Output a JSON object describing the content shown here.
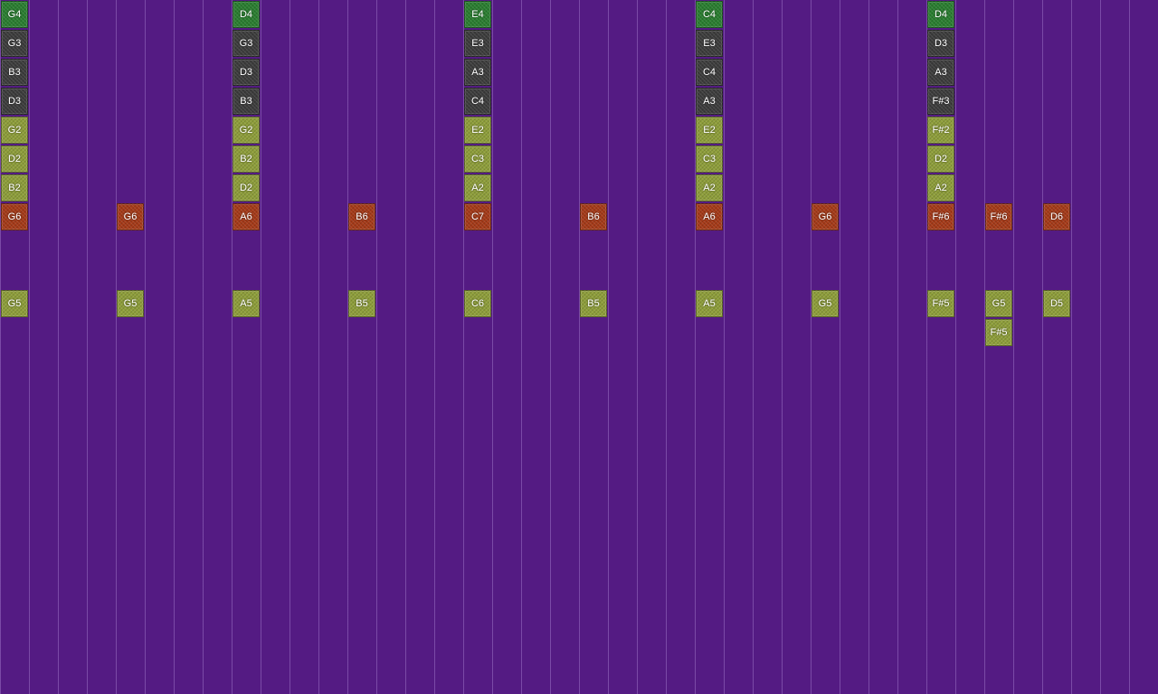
{
  "colors": {
    "background": "#541b83",
    "gridline": "#9a6fc4",
    "kinds": {
      "green": "#2a7e30",
      "dark": "#3c3c3c",
      "olive": "#8e9e3a",
      "red": "#a53a18"
    }
  },
  "sequencer": {
    "notes": [
      {
        "label": "G4",
        "kind": "green",
        "step": 0,
        "lane": 0
      },
      {
        "label": "G3",
        "kind": "dark",
        "step": 0,
        "lane": 1
      },
      {
        "label": "B3",
        "kind": "dark",
        "step": 0,
        "lane": 2
      },
      {
        "label": "D3",
        "kind": "dark",
        "step": 0,
        "lane": 3
      },
      {
        "label": "G2",
        "kind": "olive",
        "step": 0,
        "lane": 4
      },
      {
        "label": "D2",
        "kind": "olive",
        "step": 0,
        "lane": 5
      },
      {
        "label": "B2",
        "kind": "olive",
        "step": 0,
        "lane": 6
      },
      {
        "label": "G6",
        "kind": "red",
        "step": 0,
        "lane": 7
      },
      {
        "label": "G5",
        "kind": "olive",
        "step": 0,
        "lane": 10
      },
      {
        "label": "G6",
        "kind": "red",
        "step": 4,
        "lane": 7
      },
      {
        "label": "G5",
        "kind": "olive",
        "step": 4,
        "lane": 10
      },
      {
        "label": "D4",
        "kind": "green",
        "step": 8,
        "lane": 0
      },
      {
        "label": "G3",
        "kind": "dark",
        "step": 8,
        "lane": 1
      },
      {
        "label": "D3",
        "kind": "dark",
        "step": 8,
        "lane": 2
      },
      {
        "label": "B3",
        "kind": "dark",
        "step": 8,
        "lane": 3
      },
      {
        "label": "G2",
        "kind": "olive",
        "step": 8,
        "lane": 4
      },
      {
        "label": "B2",
        "kind": "olive",
        "step": 8,
        "lane": 5
      },
      {
        "label": "D2",
        "kind": "olive",
        "step": 8,
        "lane": 6
      },
      {
        "label": "A6",
        "kind": "red",
        "step": 8,
        "lane": 7
      },
      {
        "label": "A5",
        "kind": "olive",
        "step": 8,
        "lane": 10
      },
      {
        "label": "B6",
        "kind": "red",
        "step": 12,
        "lane": 7
      },
      {
        "label": "B5",
        "kind": "olive",
        "step": 12,
        "lane": 10
      },
      {
        "label": "E4",
        "kind": "green",
        "step": 16,
        "lane": 0
      },
      {
        "label": "E3",
        "kind": "dark",
        "step": 16,
        "lane": 1
      },
      {
        "label": "A3",
        "kind": "dark",
        "step": 16,
        "lane": 2
      },
      {
        "label": "C4",
        "kind": "dark",
        "step": 16,
        "lane": 3
      },
      {
        "label": "E2",
        "kind": "olive",
        "step": 16,
        "lane": 4
      },
      {
        "label": "C3",
        "kind": "olive",
        "step": 16,
        "lane": 5
      },
      {
        "label": "A2",
        "kind": "olive",
        "step": 16,
        "lane": 6
      },
      {
        "label": "C7",
        "kind": "red",
        "step": 16,
        "lane": 7
      },
      {
        "label": "C6",
        "kind": "olive",
        "step": 16,
        "lane": 10
      },
      {
        "label": "B6",
        "kind": "red",
        "step": 20,
        "lane": 7
      },
      {
        "label": "B5",
        "kind": "olive",
        "step": 20,
        "lane": 10
      },
      {
        "label": "C4",
        "kind": "green",
        "step": 24,
        "lane": 0
      },
      {
        "label": "E3",
        "kind": "dark",
        "step": 24,
        "lane": 1
      },
      {
        "label": "C4",
        "kind": "dark",
        "step": 24,
        "lane": 2
      },
      {
        "label": "A3",
        "kind": "dark",
        "step": 24,
        "lane": 3
      },
      {
        "label": "E2",
        "kind": "olive",
        "step": 24,
        "lane": 4
      },
      {
        "label": "C3",
        "kind": "olive",
        "step": 24,
        "lane": 5
      },
      {
        "label": "A2",
        "kind": "olive",
        "step": 24,
        "lane": 6
      },
      {
        "label": "A6",
        "kind": "red",
        "step": 24,
        "lane": 7
      },
      {
        "label": "A5",
        "kind": "olive",
        "step": 24,
        "lane": 10
      },
      {
        "label": "G6",
        "kind": "red",
        "step": 28,
        "lane": 7
      },
      {
        "label": "G5",
        "kind": "olive",
        "step": 28,
        "lane": 10
      },
      {
        "label": "D4",
        "kind": "green",
        "step": 32,
        "lane": 0
      },
      {
        "label": "D3",
        "kind": "dark",
        "step": 32,
        "lane": 1
      },
      {
        "label": "A3",
        "kind": "dark",
        "step": 32,
        "lane": 2
      },
      {
        "label": "F#3",
        "kind": "dark",
        "step": 32,
        "lane": 3
      },
      {
        "label": "F#2",
        "kind": "olive",
        "step": 32,
        "lane": 4
      },
      {
        "label": "D2",
        "kind": "olive",
        "step": 32,
        "lane": 5
      },
      {
        "label": "A2",
        "kind": "olive",
        "step": 32,
        "lane": 6
      },
      {
        "label": "F#6",
        "kind": "red",
        "step": 32,
        "lane": 7
      },
      {
        "label": "F#5",
        "kind": "olive",
        "step": 32,
        "lane": 10
      },
      {
        "label": "F#6",
        "kind": "red",
        "step": 34,
        "lane": 7
      },
      {
        "label": "G5",
        "kind": "olive",
        "step": 34,
        "lane": 10
      },
      {
        "label": "F#5",
        "kind": "olive",
        "step": 34,
        "lane": 11
      },
      {
        "label": "D6",
        "kind": "red",
        "step": 36,
        "lane": 7
      },
      {
        "label": "D5",
        "kind": "olive",
        "step": 36,
        "lane": 10
      }
    ]
  }
}
